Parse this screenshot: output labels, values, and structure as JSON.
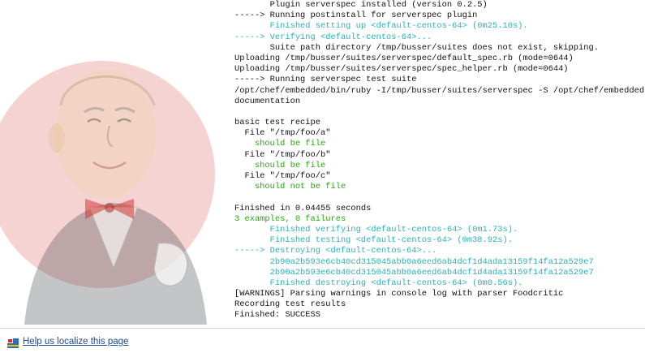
{
  "console": {
    "lines": [
      {
        "text": "       Plugin serverspec installed (version 0.2.5)",
        "color": "plain"
      },
      {
        "text": "-----> Running postinstall for serverspec plugin",
        "color": "plain"
      },
      {
        "text": "       Finished setting up <default-centos-64> (0m25.10s).",
        "color": "cyan"
      },
      {
        "text": "-----> Verifying <default-centos-64>...",
        "color": "cyan"
      },
      {
        "text": "       Suite path directory /tmp/busser/suites does not exist, skipping.",
        "color": "plain"
      },
      {
        "text": "Uploading /tmp/busser/suites/serverspec/default_spec.rb (mode=0644)",
        "color": "plain"
      },
      {
        "text": "Uploading /tmp/busser/suites/serverspec/spec_helper.rb (mode=0644)",
        "color": "plain"
      },
      {
        "text": "-----> Running serverspec test suite",
        "color": "plain"
      },
      {
        "text": "/opt/chef/embedded/bin/ruby -I/tmp/busser/suites/serverspec -S /opt/chef/embedded",
        "color": "plain"
      },
      {
        "text": "documentation",
        "color": "plain"
      },
      {
        "text": "",
        "color": "plain"
      },
      {
        "text": "basic test recipe",
        "color": "plain"
      },
      {
        "text": "  File \"/tmp/foo/a\"",
        "color": "plain"
      },
      {
        "text": "    should be file",
        "color": "green"
      },
      {
        "text": "  File \"/tmp/foo/b\"",
        "color": "plain"
      },
      {
        "text": "    should be file",
        "color": "green"
      },
      {
        "text": "  File \"/tmp/foo/c\"",
        "color": "plain"
      },
      {
        "text": "    should not be file",
        "color": "green"
      },
      {
        "text": "",
        "color": "plain"
      },
      {
        "text": "Finished in 0.04455 seconds",
        "color": "plain"
      },
      {
        "text": "3 examples, 0 failures",
        "color": "green"
      },
      {
        "text": "       Finished verifying <default-centos-64> (0m1.73s).",
        "color": "cyan"
      },
      {
        "text": "       Finished testing <default-centos-64> (0m38.92s).",
        "color": "cyan"
      },
      {
        "text": "-----> Destroying <default-centos-64>...",
        "color": "cyan"
      },
      {
        "text": "       2b90a2b593e6cb40cd315045abb0a6eed6ab4dcf1d4ada13159f14fa12a529e7",
        "color": "cyan"
      },
      {
        "text": "       2b90a2b593e6cb40cd315045abb0a6eed6ab4dcf1d4ada13159f14fa12a529e7",
        "color": "cyan"
      },
      {
        "text": "       Finished destroying <default-centos-64> (0m0.56s).",
        "color": "cyan"
      },
      {
        "text": "[WARNINGS] Parsing warnings in console log with parser Foodcritic",
        "color": "plain"
      },
      {
        "text": "Recording test results",
        "color": "plain"
      },
      {
        "text": "Finished: SUCCESS",
        "color": "plain"
      }
    ]
  },
  "footer": {
    "localize_link": "Help us localize this page",
    "flag_icon": "flag-icon"
  },
  "colors": {
    "cyan": "#2bb0b8",
    "green": "#2aa511",
    "plain": "#111111",
    "link": "#204a87",
    "mascot_circle": "#d33833"
  }
}
